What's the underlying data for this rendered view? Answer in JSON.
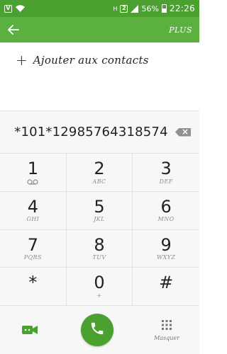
{
  "status_bar": {
    "left_badge": "V",
    "network": "H",
    "sim": "2",
    "battery": "56%",
    "time": "22:26"
  },
  "app_bar": {
    "action_label": "PLUS"
  },
  "add_contacts": {
    "label": "Ajouter aux contacts"
  },
  "display": {
    "number": "*101*12985764318574"
  },
  "keypad": [
    {
      "digit": "1",
      "letters": ""
    },
    {
      "digit": "2",
      "letters": "ABC"
    },
    {
      "digit": "3",
      "letters": "DEF"
    },
    {
      "digit": "4",
      "letters": "GHI"
    },
    {
      "digit": "5",
      "letters": "JKL"
    },
    {
      "digit": "6",
      "letters": "MNO"
    },
    {
      "digit": "7",
      "letters": "PQRS"
    },
    {
      "digit": "8",
      "letters": "TUV"
    },
    {
      "digit": "9",
      "letters": "WXYZ"
    },
    {
      "digit": "*",
      "letters": ""
    },
    {
      "digit": "0",
      "letters": "+"
    },
    {
      "digit": "#",
      "letters": ""
    }
  ],
  "bottom_bar": {
    "hide_label": "Masquer"
  },
  "colors": {
    "status_bar": "#4aa12f",
    "app_bar": "#5bb03f",
    "accent": "#4aa12f"
  },
  "icons": {
    "back": "arrow-left-icon",
    "voicemail": "voicemail-icon",
    "backspace": "backspace-icon",
    "video_call": "video-call-icon",
    "call": "phone-icon",
    "dialpad": "dialpad-icon"
  }
}
